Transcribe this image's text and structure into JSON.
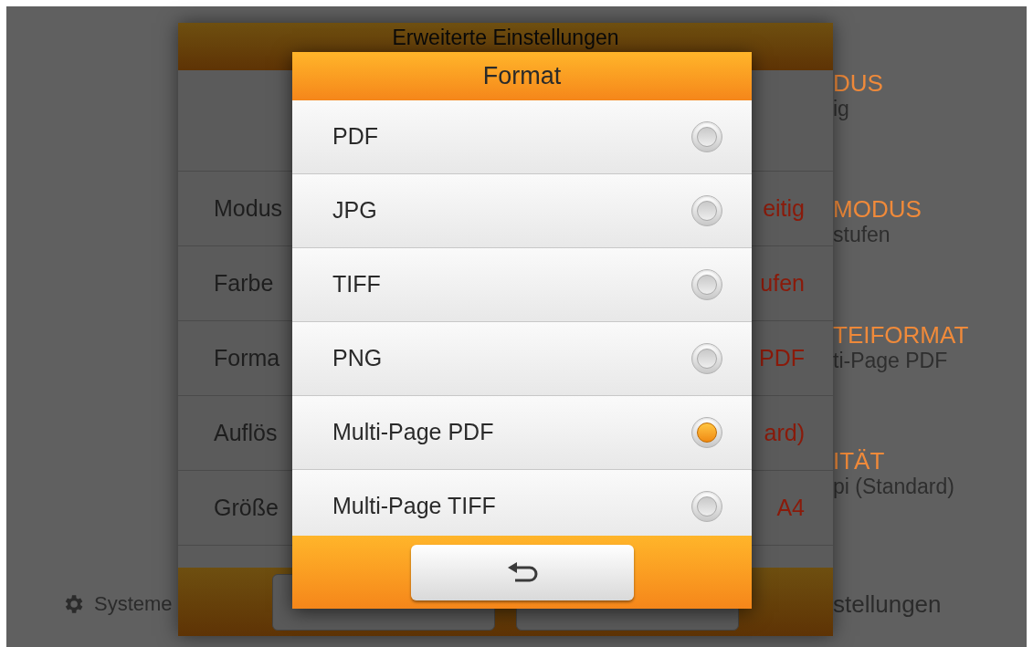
{
  "background": {
    "summary": [
      {
        "title": "DUS",
        "value": "ig"
      },
      {
        "title": "MODUS",
        "value": "stufen"
      },
      {
        "title": "TEIFORMAT",
        "value": "ti-Page PDF"
      },
      {
        "title": "ITÄT",
        "value": "pi (Standard)"
      }
    ],
    "footer_left": "Systeme",
    "footer_right": "stellungen"
  },
  "settings_dialog": {
    "title": "Erweiterte Einstellungen",
    "rows": [
      {
        "label": "Modus",
        "value": "eitig"
      },
      {
        "label": "Farbe",
        "value": "ufen"
      },
      {
        "label": "Forma",
        "value": "PDF"
      },
      {
        "label": "Auflös",
        "value": "ard)"
      },
      {
        "label": "Größe",
        "value": "A4"
      }
    ]
  },
  "format_dialog": {
    "title": "Format",
    "options": [
      {
        "label": "PDF",
        "selected": false
      },
      {
        "label": "JPG",
        "selected": false
      },
      {
        "label": "TIFF",
        "selected": false
      },
      {
        "label": "PNG",
        "selected": false
      },
      {
        "label": "Multi-Page PDF",
        "selected": true
      },
      {
        "label": "Multi-Page TIFF",
        "selected": false
      }
    ]
  }
}
